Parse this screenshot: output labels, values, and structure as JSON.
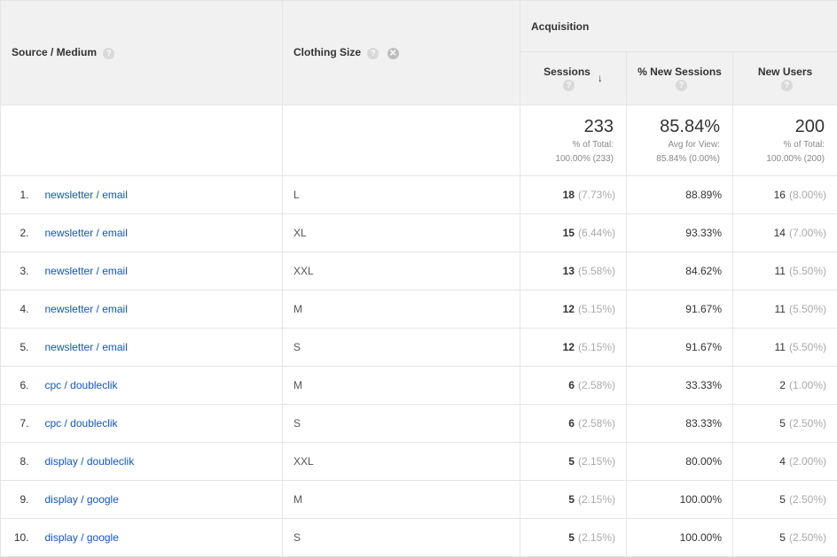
{
  "headers": {
    "sourceMedium": "Source / Medium",
    "clothingSize": "Clothing Size",
    "acquisition": "Acquisition",
    "sessions": "Sessions",
    "pctNewSessions": "% New Sessions",
    "newUsers": "New Users"
  },
  "summary": {
    "sessions": {
      "value": "233",
      "sub1": "% of Total:",
      "sub2": "100.00% (233)"
    },
    "pctNewSessions": {
      "value": "85.84%",
      "sub1": "Avg for View:",
      "sub2": "85.84% (0.00%)"
    },
    "newUsers": {
      "value": "200",
      "sub1": "% of Total:",
      "sub2": "100.00% (200)"
    }
  },
  "rows": [
    {
      "idx": "1.",
      "source": "newsletter / email",
      "clothing": "L",
      "sessions": "18",
      "sessionsPct": "(7.73%)",
      "pctNew": "88.89%",
      "newUsers": "16",
      "newUsersPct": "(8.00%)"
    },
    {
      "idx": "2.",
      "source": "newsletter / email",
      "clothing": "XL",
      "sessions": "15",
      "sessionsPct": "(6.44%)",
      "pctNew": "93.33%",
      "newUsers": "14",
      "newUsersPct": "(7.00%)"
    },
    {
      "idx": "3.",
      "source": "newsletter / email",
      "clothing": "XXL",
      "sessions": "13",
      "sessionsPct": "(5.58%)",
      "pctNew": "84.62%",
      "newUsers": "11",
      "newUsersPct": "(5.50%)"
    },
    {
      "idx": "4.",
      "source": "newsletter / email",
      "clothing": "M",
      "sessions": "12",
      "sessionsPct": "(5.15%)",
      "pctNew": "91.67%",
      "newUsers": "11",
      "newUsersPct": "(5.50%)"
    },
    {
      "idx": "5.",
      "source": "newsletter / email",
      "clothing": "S",
      "sessions": "12",
      "sessionsPct": "(5.15%)",
      "pctNew": "91.67%",
      "newUsers": "11",
      "newUsersPct": "(5.50%)"
    },
    {
      "idx": "6.",
      "source": "cpc / doubleclik",
      "clothing": "M",
      "sessions": "6",
      "sessionsPct": "(2.58%)",
      "pctNew": "33.33%",
      "newUsers": "2",
      "newUsersPct": "(1.00%)"
    },
    {
      "idx": "7.",
      "source": "cpc / doubleclik",
      "clothing": "S",
      "sessions": "6",
      "sessionsPct": "(2.58%)",
      "pctNew": "83.33%",
      "newUsers": "5",
      "newUsersPct": "(2.50%)"
    },
    {
      "idx": "8.",
      "source": "display / doubleclik",
      "clothing": "XXL",
      "sessions": "5",
      "sessionsPct": "(2.15%)",
      "pctNew": "80.00%",
      "newUsers": "4",
      "newUsersPct": "(2.00%)"
    },
    {
      "idx": "9.",
      "source": "display / google",
      "clothing": "M",
      "sessions": "5",
      "sessionsPct": "(2.15%)",
      "pctNew": "100.00%",
      "newUsers": "5",
      "newUsersPct": "(2.50%)"
    },
    {
      "idx": "10.",
      "source": "display / google",
      "clothing": "S",
      "sessions": "5",
      "sessionsPct": "(2.15%)",
      "pctNew": "100.00%",
      "newUsers": "5",
      "newUsersPct": "(2.50%)"
    }
  ]
}
